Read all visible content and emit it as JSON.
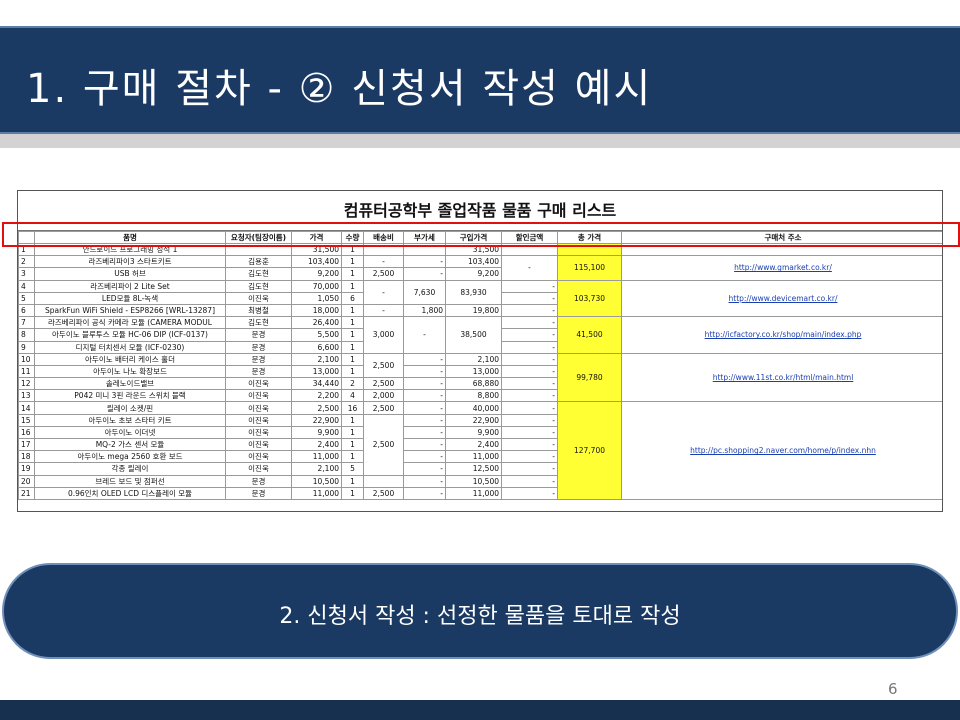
{
  "slide": {
    "title": "1. 구매 절차 - ② 신청서 작성 예시",
    "subtitle": "2. 신청서 작성 : 선정한 물품을 토대로 작성",
    "page_number": "6"
  },
  "sheet": {
    "title": "컴퓨터공학부 졸업작품 물품 구매 리스트",
    "headers": [
      "품명",
      "요청자(팀장이름)",
      "가격",
      "수량",
      "배송비",
      "부가세",
      "구입가격",
      "할인금액",
      "총 가격",
      "구매처 주소"
    ],
    "rows": [
      {
        "no": "1",
        "name": "안드로이드 프로그래밍 정석 1",
        "requester": "",
        "price": "31,500",
        "qty": "1",
        "ship": "",
        "vat": "",
        "buy": "31,500",
        "disc": ""
      },
      {
        "no": "2",
        "name": "라즈베리파이3 스타트키트",
        "requester": "김용훈",
        "price": "103,400",
        "qty": "1",
        "ship": "-",
        "vat": "-",
        "buy": "103,400",
        "disc": "-"
      },
      {
        "no": "3",
        "name": "USB 허브",
        "requester": "김도현",
        "price": "9,200",
        "qty": "1",
        "ship": "2,500",
        "vat": "-",
        "buy": "9,200",
        "disc": ""
      },
      {
        "no": "4",
        "name": "라즈베리파이 2 Lite Set",
        "requester": "김도현",
        "price": "70,000",
        "qty": "1",
        "ship": "-",
        "vat": "7,630",
        "buy": "83,930",
        "disc": "-"
      },
      {
        "no": "5",
        "name": "LED모듈 8L-녹색",
        "requester": "이진욱",
        "price": "1,050",
        "qty": "6",
        "ship": "",
        "vat": "",
        "buy": "",
        "disc": "-"
      },
      {
        "no": "6",
        "name": "SparkFun WiFi Shield - ESP8266 [WRL-13287]",
        "requester": "최병철",
        "price": "18,000",
        "qty": "1",
        "ship": "-",
        "vat": "1,800",
        "buy": "19,800",
        "disc": "-"
      },
      {
        "no": "7",
        "name": "라즈베리파이 공식 카메라 모듈 (CAMERA MODUL",
        "requester": "김도현",
        "price": "26,400",
        "qty": "1",
        "ship": "3,000",
        "vat": "-",
        "buy": "38,500",
        "disc": "-"
      },
      {
        "no": "8",
        "name": "아두이노 블루투스 모듈 HC-06 DIP (ICF-0137)",
        "requester": "문경",
        "price": "5,500",
        "qty": "1",
        "ship": "",
        "vat": "",
        "buy": "",
        "disc": "-"
      },
      {
        "no": "9",
        "name": "디지털 터치센서 모듈 (ICF-0230)",
        "requester": "문경",
        "price": "6,600",
        "qty": "1",
        "ship": "",
        "vat": "",
        "buy": "",
        "disc": "-"
      },
      {
        "no": "10",
        "name": "아두이노 배터리 케이스 홀더",
        "requester": "문경",
        "price": "2,100",
        "qty": "1",
        "ship": "2,500",
        "vat": "-",
        "buy": "2,100",
        "disc": "-"
      },
      {
        "no": "11",
        "name": "아두이노 나노 확장보드",
        "requester": "문경",
        "price": "13,000",
        "qty": "1",
        "ship": "",
        "vat": "-",
        "buy": "13,000",
        "disc": "-"
      },
      {
        "no": "12",
        "name": "솔레노이드밸브",
        "requester": "이진욱",
        "price": "34,440",
        "qty": "2",
        "ship": "2,500",
        "vat": "-",
        "buy": "68,880",
        "disc": "-"
      },
      {
        "no": "13",
        "name": "P042 미니 3핀 라운드 스위치 블랙",
        "requester": "이진욱",
        "price": "2,200",
        "qty": "4",
        "ship": "2,000",
        "vat": "-",
        "buy": "8,800",
        "disc": "-"
      },
      {
        "no": "14",
        "name": "릴레이 소켓/핀",
        "requester": "이진욱",
        "price": "2,500",
        "qty": "16",
        "ship": "2,500",
        "vat": "-",
        "buy": "40,000",
        "disc": "-"
      },
      {
        "no": "15",
        "name": "아두이노 초보 스타터 키트",
        "requester": "이진욱",
        "price": "22,900",
        "qty": "1",
        "ship": "2,500",
        "vat": "-",
        "buy": "22,900",
        "disc": "-"
      },
      {
        "no": "16",
        "name": "아두이노 이더넷",
        "requester": "이진욱",
        "price": "9,900",
        "qty": "1",
        "ship": "",
        "vat": "-",
        "buy": "9,900",
        "disc": "-"
      },
      {
        "no": "17",
        "name": "MQ-2 가스 센서 모듈",
        "requester": "이진욱",
        "price": "2,400",
        "qty": "1",
        "ship": "",
        "vat": "-",
        "buy": "2,400",
        "disc": "-"
      },
      {
        "no": "18",
        "name": "아두이노 mega 2560 호환 보드",
        "requester": "이진욱",
        "price": "11,000",
        "qty": "1",
        "ship": "",
        "vat": "-",
        "buy": "11,000",
        "disc": "-"
      },
      {
        "no": "19",
        "name": "각종 릴레이",
        "requester": "이진욱",
        "price": "2,100",
        "qty": "5",
        "ship": "",
        "vat": "-",
        "buy": "12,500",
        "disc": "-"
      },
      {
        "no": "20",
        "name": "브레드 보드 및 점퍼선",
        "requester": "문경",
        "price": "10,500",
        "qty": "1",
        "ship": "",
        "vat": "-",
        "buy": "10,500",
        "disc": "-"
      },
      {
        "no": "21",
        "name": "0.96인치 OLED LCD 디스플레이 모듈",
        "requester": "문경",
        "price": "11,000",
        "qty": "1",
        "ship": "2,500",
        "vat": "-",
        "buy": "11,000",
        "disc": "-"
      }
    ],
    "groups": [
      {
        "total": "115,100",
        "url": "http://www.gmarket.co.kr/"
      },
      {
        "total": "103,730",
        "url": "http://www.devicemart.co.kr/"
      },
      {
        "total": "41,500",
        "url": "http://icfactory.co.kr/shop/main/index.php"
      },
      {
        "total": "99,780",
        "url": "http://www.11st.co.kr/html/main.html"
      },
      {
        "total": "127,700",
        "url": "http://pc.shopping2.naver.com/home/p/index.nhn"
      }
    ]
  },
  "colors": {
    "title_bar": "#1b3a63",
    "highlight_total": "#ffff33",
    "red_outline": "#e01010",
    "link": "#1a3fb0"
  }
}
